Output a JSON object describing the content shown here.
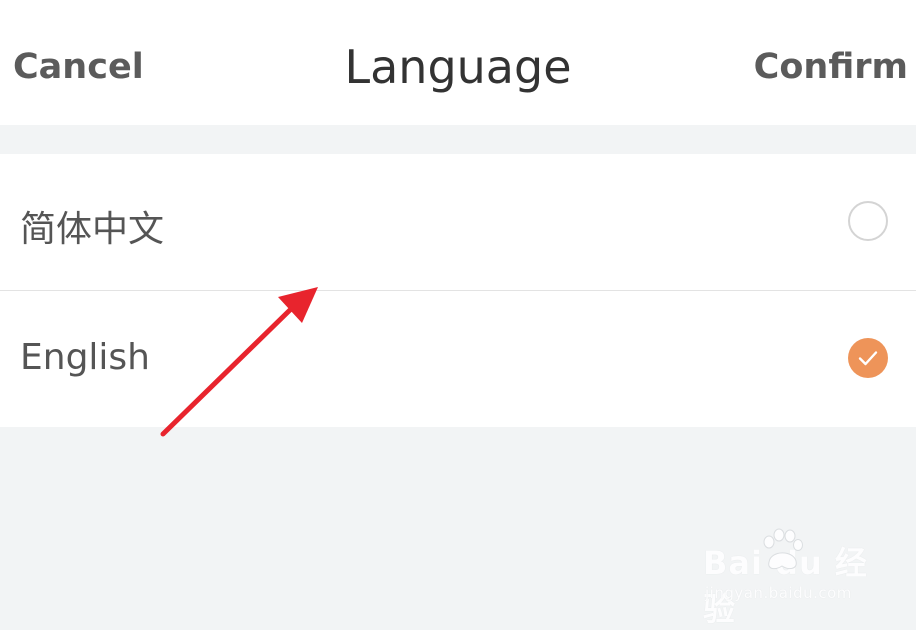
{
  "header": {
    "cancel_label": "Cancel",
    "title": "Language",
    "confirm_label": "Confirm"
  },
  "languages": [
    {
      "label": "简体中文",
      "selected": false
    },
    {
      "label": "English",
      "selected": true
    }
  ],
  "colors": {
    "accent": "#ee9459",
    "annotation_arrow": "#e8242d",
    "page_background": "#f2f4f5"
  },
  "watermark": {
    "logo_text": "Bai  du 经验",
    "sub_text": "jingyan.baidu.com"
  }
}
